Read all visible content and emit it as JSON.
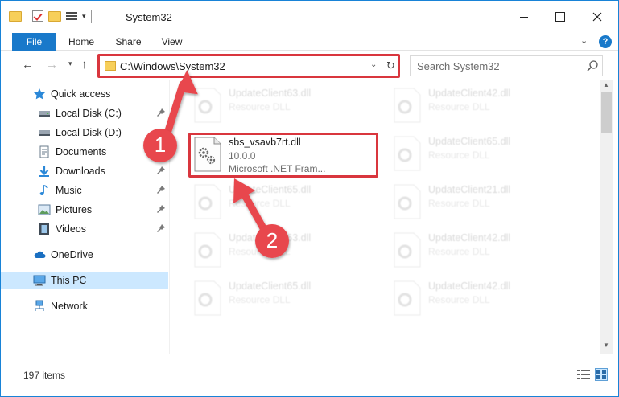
{
  "window": {
    "title": "System32",
    "accent": "#1979ca",
    "highlight_color": "#d9363e"
  },
  "ribbon": {
    "tabs": [
      "File",
      "Home",
      "Share",
      "View"
    ]
  },
  "address_bar": {
    "path": "C:\\Windows\\System32",
    "search_placeholder": "Search System32"
  },
  "sidebar": {
    "items": [
      {
        "label": "Quick access",
        "icon": "star-icon",
        "pinned": false
      },
      {
        "label": "Local Disk (C:)",
        "icon": "drive-icon",
        "pinned": true
      },
      {
        "label": "Local Disk (D:)",
        "icon": "drive-icon",
        "pinned": false
      },
      {
        "label": "Documents",
        "icon": "documents-icon",
        "pinned": true
      },
      {
        "label": "Downloads",
        "icon": "download-icon",
        "pinned": true
      },
      {
        "label": "Music",
        "icon": "music-icon",
        "pinned": true
      },
      {
        "label": "Pictures",
        "icon": "pictures-icon",
        "pinned": true
      },
      {
        "label": "Videos",
        "icon": "videos-icon",
        "pinned": true
      },
      {
        "label": "OneDrive",
        "icon": "onedrive-icon",
        "pinned": false
      },
      {
        "label": "This PC",
        "icon": "computer-icon",
        "selected": true
      },
      {
        "label": "Network",
        "icon": "network-icon",
        "pinned": false
      }
    ]
  },
  "files": {
    "highlighted": {
      "name": "sbs_vsavb7rt.dll",
      "version": "10.0.0",
      "description": "Microsoft .NET Fram..."
    },
    "background": [
      {
        "name": "UpdateClient63.dll",
        "type": "Resource DLL"
      },
      {
        "name": "UpdateClient42.dll",
        "type": "Resource DLL"
      },
      {
        "name": "UpdateClient65.dll",
        "type": "Resource DLL"
      },
      {
        "name": "UpdateClient65.dll",
        "type": "Resource DLL"
      },
      {
        "name": "UpdateClient21.dll",
        "type": "Resource DLL"
      },
      {
        "name": "UpdateClient63.dll",
        "type": "Resource DLL"
      },
      {
        "name": "UpdateClient42.dll",
        "type": "Resource DLL"
      },
      {
        "name": "UpdateClient65.dll",
        "type": "Resource DLL"
      },
      {
        "name": "UpdateClient42.dll",
        "type": "Resource DLL"
      }
    ]
  },
  "status": {
    "item_count": "197 items"
  },
  "annotations": {
    "step1": "1",
    "step2": "2"
  }
}
